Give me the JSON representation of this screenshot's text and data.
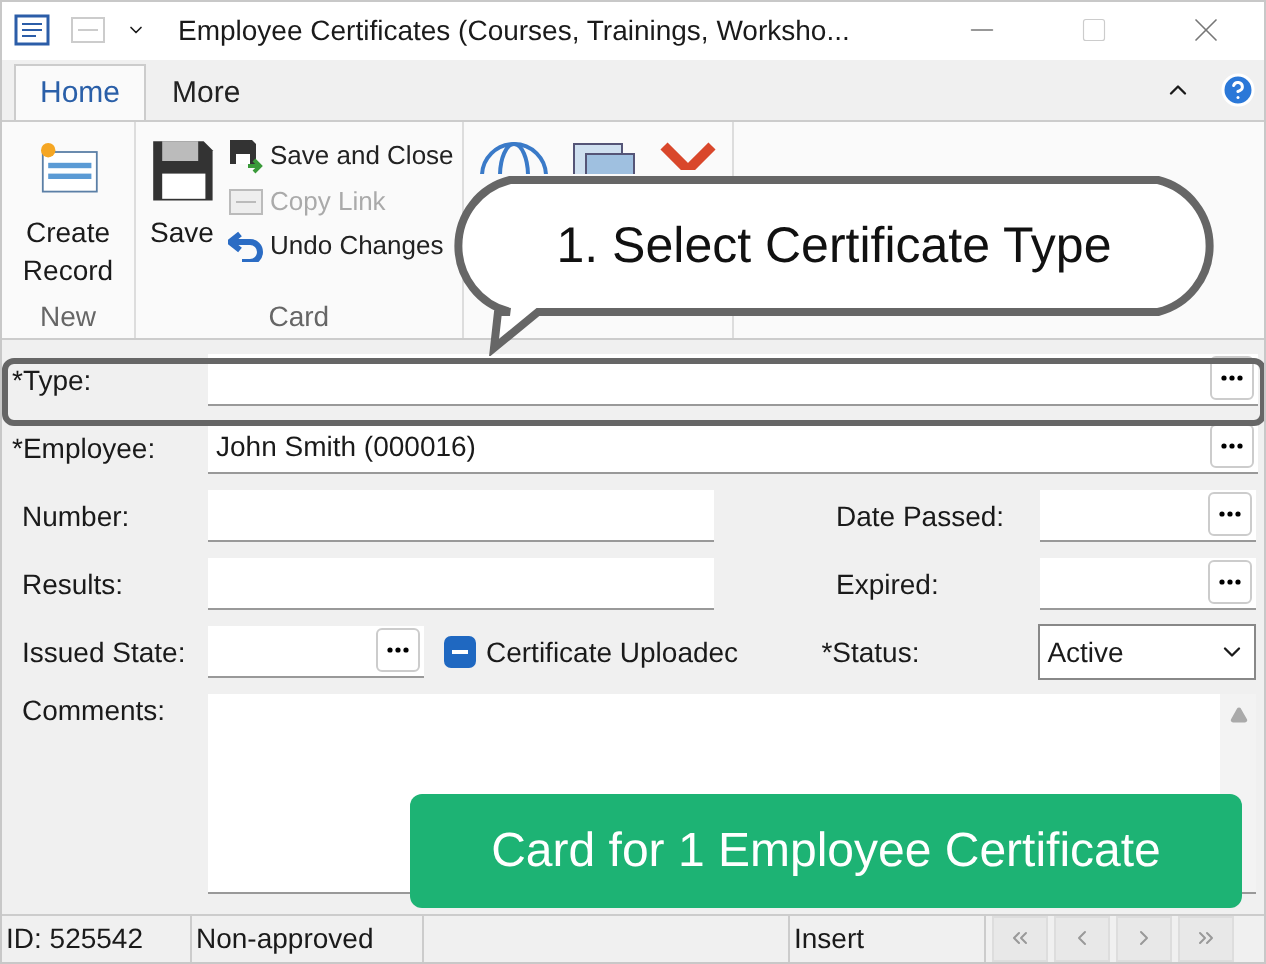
{
  "window": {
    "title": "Employee Certificates (Courses, Trainings, Worksho..."
  },
  "tabs": [
    {
      "label": "Home",
      "selected": true
    },
    {
      "label": "More",
      "selected": false
    }
  ],
  "ribbon": {
    "groups": [
      {
        "label": "New",
        "large": [
          {
            "label": "Create Record",
            "kind": "create"
          }
        ]
      },
      {
        "label": "Card",
        "large": [
          {
            "label": "Save",
            "kind": "save"
          }
        ],
        "small": [
          {
            "label": "Save and Close",
            "kind": "save-close",
            "disabled": false
          },
          {
            "label": "Copy Link",
            "kind": "link",
            "disabled": true
          },
          {
            "label": "Undo Changes",
            "kind": "undo",
            "disabled": false
          }
        ]
      },
      {
        "large": [
          {
            "kind": "globe"
          },
          {
            "kind": "copies"
          },
          {
            "kind": "delete"
          }
        ]
      }
    ]
  },
  "callout": "1. Select Certificate Type",
  "form": {
    "type": {
      "label": "*Type:"
    },
    "employee": {
      "label": "*Employee:",
      "value": "John Smith (000016)"
    },
    "number": {
      "label": "Number:"
    },
    "date_passed": {
      "label": "Date Passed:"
    },
    "results": {
      "label": "Results:"
    },
    "expired": {
      "label": "Expired:"
    },
    "issued_state": {
      "label": "Issued State:"
    },
    "certificate_uploaded": {
      "label": "Certificate Uploadec",
      "checked": false,
      "indeterminate": true
    },
    "status": {
      "label": "*Status:",
      "value": "Active"
    },
    "comments": {
      "label": "Comments:"
    }
  },
  "banner": "Card for 1 Employee Certificate",
  "status_bar": {
    "id": "ID: 525542",
    "approval": "Non-approved",
    "mode": "Insert"
  }
}
